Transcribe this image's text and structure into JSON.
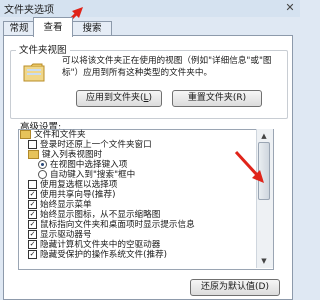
{
  "window": {
    "title": "文件夹选项",
    "close": "✕"
  },
  "tabs": [
    {
      "label": "常规"
    },
    {
      "label": "查看"
    },
    {
      "label": "搜索"
    }
  ],
  "folder_view": {
    "title": "文件夹视图",
    "description": "可以将该文件夹正在使用的视图（例如\"详细信息\"或\"图标\"）应用到所有这种类型的文件夹中。",
    "apply_label": "应用到文件夹",
    "apply_hotkey": "L",
    "reset_label": "重置文件夹(R)"
  },
  "advanced": {
    "label": "高级设置:",
    "items": [
      {
        "type": "folder",
        "text": "文件和文件夹"
      },
      {
        "type": "check",
        "checked": false,
        "text": "登录时还原上一个文件夹窗口"
      },
      {
        "type": "folder",
        "text": "键入列表视图时"
      },
      {
        "type": "radio",
        "checked": true,
        "text": "在视图中选择键入项"
      },
      {
        "type": "radio",
        "checked": false,
        "text": "自动键入到\"搜索\"框中"
      },
      {
        "type": "check",
        "checked": false,
        "text": "使用复选框以选择项"
      },
      {
        "type": "check",
        "checked": true,
        "text": "使用共享向导(推荐)"
      },
      {
        "type": "check",
        "checked": true,
        "text": "始终显示菜单"
      },
      {
        "type": "check",
        "checked": true,
        "text": "始终显示图标，从不显示缩略图"
      },
      {
        "type": "check",
        "checked": true,
        "text": "鼠标指向文件夹和桌面项时显示提示信息"
      },
      {
        "type": "check",
        "checked": true,
        "text": "显示驱动器号"
      },
      {
        "type": "check",
        "checked": true,
        "text": "隐藏计算机文件夹中的空驱动器"
      },
      {
        "type": "check",
        "checked": true,
        "text": "隐藏受保护的操作系统文件(推荐)"
      }
    ],
    "restore_label": "还原为默认值(D)"
  },
  "colors": {
    "annotation_arrow": "#e0241a",
    "panel_bg": "#ffffff",
    "window_bg": "#dfe8f3"
  }
}
